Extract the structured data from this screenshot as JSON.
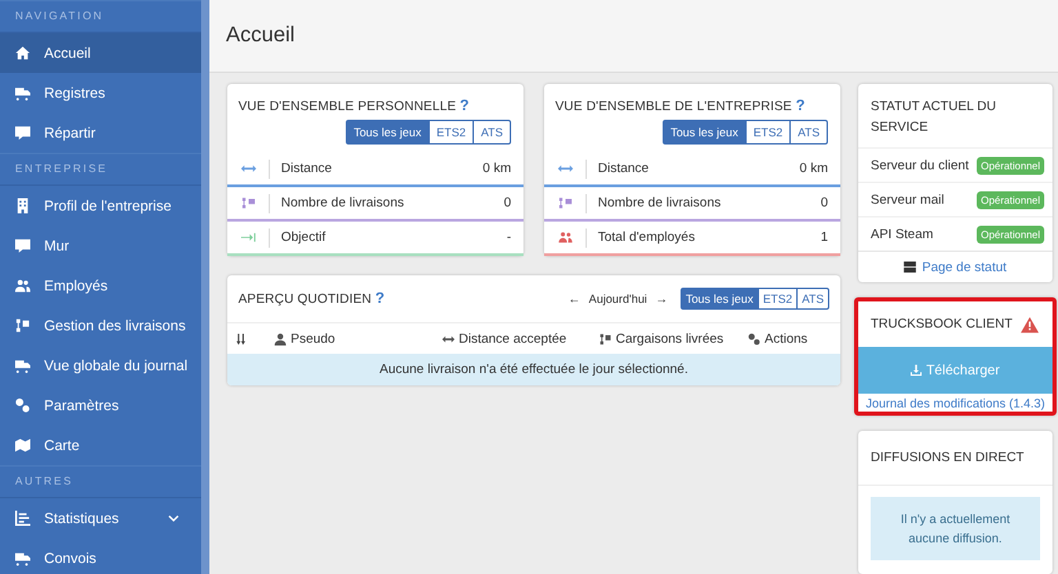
{
  "sidebar": {
    "sections": [
      {
        "title": "NAVIGATION",
        "items": [
          {
            "label": "Accueil",
            "selected": true,
            "kind": "link"
          },
          {
            "label": "Registres",
            "selected": false,
            "kind": "link"
          },
          {
            "label": "Répartir",
            "selected": false,
            "kind": "link"
          }
        ]
      },
      {
        "title": "ENTREPRISE",
        "items": [
          {
            "label": "Profil de l'entreprise",
            "selected": false,
            "kind": "link"
          },
          {
            "label": "Mur",
            "selected": false,
            "kind": "link"
          },
          {
            "label": "Employés",
            "selected": false,
            "kind": "link"
          },
          {
            "label": "Gestion des livraisons",
            "selected": false,
            "kind": "link"
          },
          {
            "label": "Vue globale du journal",
            "selected": false,
            "kind": "link"
          },
          {
            "label": "Paramètres",
            "selected": false,
            "kind": "link"
          },
          {
            "label": "Carte",
            "selected": false,
            "kind": "link"
          }
        ]
      },
      {
        "title": "AUTRES",
        "items": [
          {
            "label": "Statistiques",
            "selected": false,
            "kind": "group"
          },
          {
            "label": "Convois",
            "selected": false,
            "kind": "link"
          }
        ]
      }
    ]
  },
  "header": {
    "title": "Accueil"
  },
  "overview_cards": [
    {
      "title": "VUE D'ENSEMBLE PERSONNELLE",
      "help": "?",
      "filters": [
        {
          "label": "Tous les jeux",
          "selected": true
        },
        {
          "label": "ETS2",
          "selected": false
        },
        {
          "label": "ATS",
          "selected": false
        }
      ],
      "rows": [
        {
          "kind": "distance",
          "label": "Distance",
          "value": "0 km",
          "color": "#6a9fe0"
        },
        {
          "kind": "deliveries",
          "label": "Nombre de livraisons",
          "value": "0",
          "color": "#b9a6e0"
        },
        {
          "kind": "goal",
          "label": "Objectif",
          "value": "-",
          "color": "#a8e0c0"
        }
      ]
    },
    {
      "title": "VUE D'ENSEMBLE DE L'ENTREPRISE",
      "help": "?",
      "filters": [
        {
          "label": "Tous les jeux",
          "selected": true
        },
        {
          "label": "ETS2",
          "selected": false
        },
        {
          "label": "ATS",
          "selected": false
        }
      ],
      "rows": [
        {
          "kind": "distance",
          "label": "Distance",
          "value": "0 km",
          "color": "#6a9fe0"
        },
        {
          "kind": "deliveries",
          "label": "Nombre de livraisons",
          "value": "0",
          "color": "#b9a6e0"
        },
        {
          "kind": "employees",
          "label": "Total d'employés",
          "value": "1",
          "color": "#f0a0a0"
        }
      ]
    }
  ],
  "daily": {
    "title": "APERÇU QUOTIDIEN",
    "help": "?",
    "prev": "←",
    "day": "Aujourd'hui",
    "next": "→",
    "filters": [
      {
        "label": "Tous les jeux",
        "selected": true
      },
      {
        "label": "ETS2",
        "selected": false
      },
      {
        "label": "ATS",
        "selected": false
      }
    ],
    "columns": [
      "Pseudo",
      "Distance acceptée",
      "Cargaisons livrées",
      "Actions"
    ],
    "empty_message": "Aucune livraison n'a été effectuée le jour sélectionné."
  },
  "service_status": {
    "title": "STATUT ACTUEL DU SERVICE",
    "services": [
      {
        "name": "Serveur du client",
        "status": "Opérationnel"
      },
      {
        "name": "Serveur mail",
        "status": "Opérationnel"
      },
      {
        "name": "API Steam",
        "status": "Opérationnel"
      }
    ],
    "link": "Page de statut"
  },
  "client": {
    "title": "TRUCKSBOOK CLIENT",
    "highlighted": true,
    "button": "Télécharger",
    "link": "Journal des modifications (1.4.3)"
  },
  "live": {
    "title": "DIFFUSIONS EN DIRECT",
    "message": "Il n'y a actuellement aucune diffusion."
  }
}
